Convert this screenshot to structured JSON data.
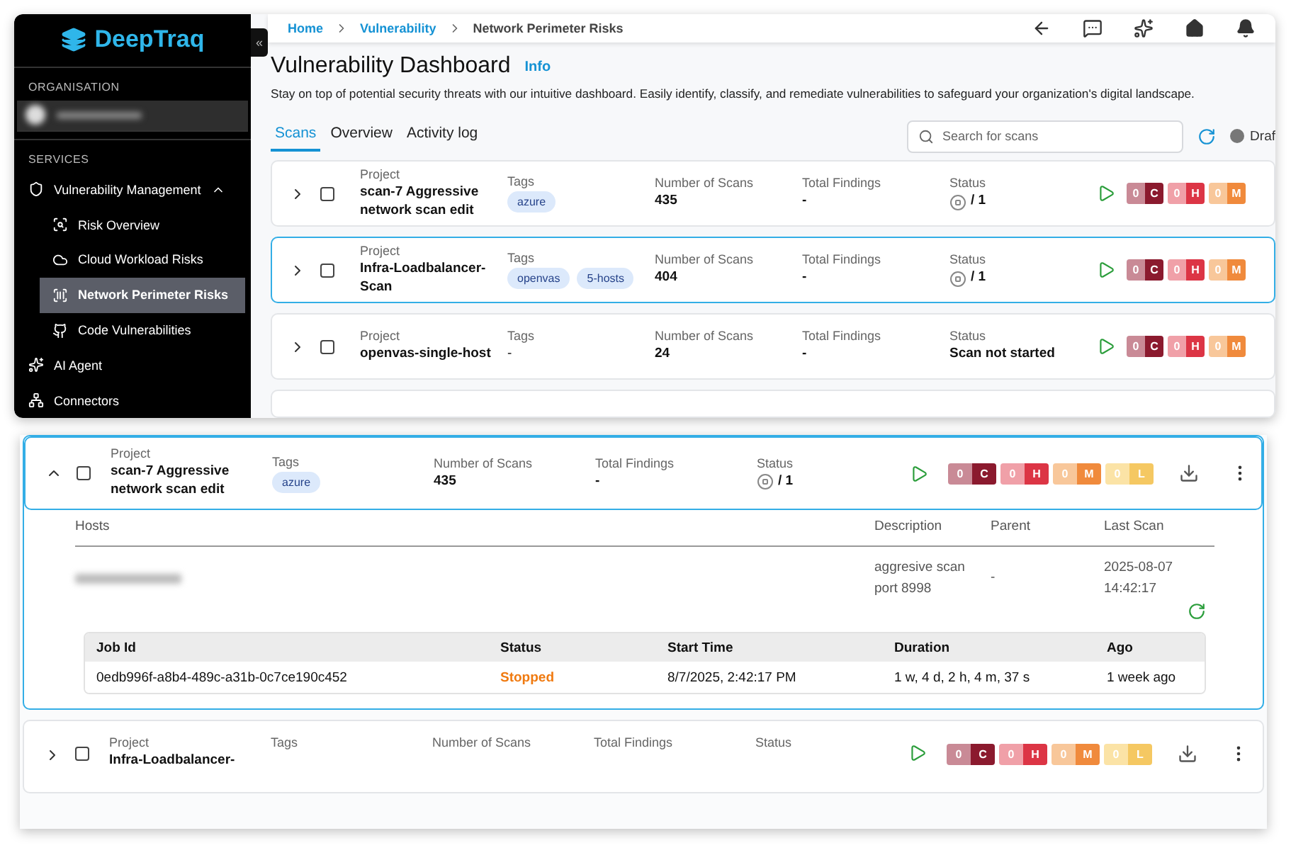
{
  "sidebar": {
    "logo": "DeepTraq",
    "collapse": "«",
    "org_label": "ORGANISATION",
    "services_label": "SERVICES",
    "items": [
      {
        "label": "Vulnerability Management",
        "expanded": true,
        "selected": false,
        "children": [
          {
            "label": "Risk Overview",
            "selected": false
          },
          {
            "label": "Cloud Workload Risks",
            "selected": false
          },
          {
            "label": "Network Perimeter Risks",
            "selected": true
          },
          {
            "label": "Code Vulnerabilities",
            "selected": false
          }
        ]
      },
      {
        "label": "AI Agent",
        "selected": false
      },
      {
        "label": "Connectors",
        "selected": false
      }
    ]
  },
  "breadcrumbs": [
    "Home",
    "Vulnerability",
    "Network Perimeter Risks"
  ],
  "page": {
    "title": "Vulnerability Dashboard",
    "info": "Info",
    "description": "Stay on top of potential security threats with our intuitive dashboard. Easily identify, classify, and remediate vulnerabilities to safeguard your organization's digital landscape."
  },
  "tabs": [
    {
      "label": "Scans",
      "selected": true
    },
    {
      "label": "Overview",
      "selected": false
    },
    {
      "label": "Activity log",
      "selected": false
    }
  ],
  "search": {
    "placeholder": "Search for scans"
  },
  "filter": {
    "label": "Draf"
  },
  "scans": [
    {
      "labels": {
        "project": "Project",
        "tags": "Tags",
        "scans": "Number of Scans",
        "findings": "Total Findings",
        "status": "Status"
      },
      "project": "scan-7 Aggressive network scan edit",
      "tags": [
        "azure"
      ],
      "scans": "435",
      "findings": "-",
      "status": {
        "kind": "stopped",
        "text": "/ 1"
      },
      "selected": false,
      "checked": false,
      "badges": [
        {
          "count": "0",
          "letter": "C"
        },
        {
          "count": "0",
          "letter": "H"
        },
        {
          "count": "0",
          "letter": "M"
        }
      ]
    },
    {
      "labels": {
        "project": "Project",
        "tags": "Tags",
        "scans": "Number of Scans",
        "findings": "Total Findings",
        "status": "Status"
      },
      "project": "Infra-Loadbalancer-Scan",
      "tags": [
        "openvas",
        "5-hosts"
      ],
      "scans": "404",
      "findings": "-",
      "status": {
        "kind": "stopped",
        "text": "/ 1"
      },
      "selected": true,
      "checked": false,
      "badges": [
        {
          "count": "0",
          "letter": "C"
        },
        {
          "count": "0",
          "letter": "H"
        },
        {
          "count": "0",
          "letter": "M"
        }
      ]
    },
    {
      "labels": {
        "project": "Project",
        "tags": "Tags",
        "scans": "Number of Scans",
        "findings": "Total Findings",
        "status": "Status"
      },
      "project": "openvas-single-host",
      "tags_text": "-",
      "scans": "24",
      "findings": "-",
      "status": {
        "kind": "text",
        "text": "Scan not started"
      },
      "selected": false,
      "checked": false,
      "badges": [
        {
          "count": "0",
          "letter": "C"
        },
        {
          "count": "0",
          "letter": "H"
        },
        {
          "count": "0",
          "letter": "M"
        }
      ]
    }
  ],
  "detail": {
    "labels": {
      "project": "Project",
      "tags": "Tags",
      "scans": "Number of Scans",
      "findings": "Total Findings",
      "status": "Status"
    },
    "expanded": true,
    "selected": true,
    "checked": false,
    "project": "scan-7 Aggressive network scan edit",
    "tags": [
      "azure"
    ],
    "scans": "435",
    "findings": "-",
    "status": {
      "kind": "stopped",
      "text": "/ 1"
    },
    "badges": [
      {
        "count": "0",
        "letter": "C"
      },
      {
        "count": "0",
        "letter": "H"
      },
      {
        "count": "0",
        "letter": "M"
      },
      {
        "count": "0",
        "letter": "L"
      }
    ],
    "hosts_columns": [
      "Hosts",
      "Description",
      "Parent",
      "Last Scan"
    ],
    "host": {
      "description": "aggresive scan port 8998",
      "parent": "-",
      "last_scan": "2025-08-07 14:42:17"
    },
    "jobs_columns": [
      "Job Id",
      "Status",
      "Start Time",
      "Duration",
      "Ago"
    ],
    "jobs": [
      {
        "id": "0edb996f-a8b4-489c-a31b-0c7ce190c452",
        "status": "Stopped",
        "start": "8/7/2025, 2:42:17 PM",
        "duration": "1 w, 4 d, 2 h, 4 m, 37 s",
        "ago": "1 week ago"
      }
    ]
  },
  "next_row": {
    "labels": {
      "project": "Project",
      "tags": "Tags",
      "scans": "Number of Scans",
      "findings": "Total Findings",
      "status": "Status"
    },
    "project": "Infra-Loadbalancer-",
    "checked": false,
    "badges": [
      {
        "count": "0",
        "letter": "C"
      },
      {
        "count": "0",
        "letter": "H"
      },
      {
        "count": "0",
        "letter": "M"
      },
      {
        "count": "0",
        "letter": "L"
      }
    ]
  }
}
